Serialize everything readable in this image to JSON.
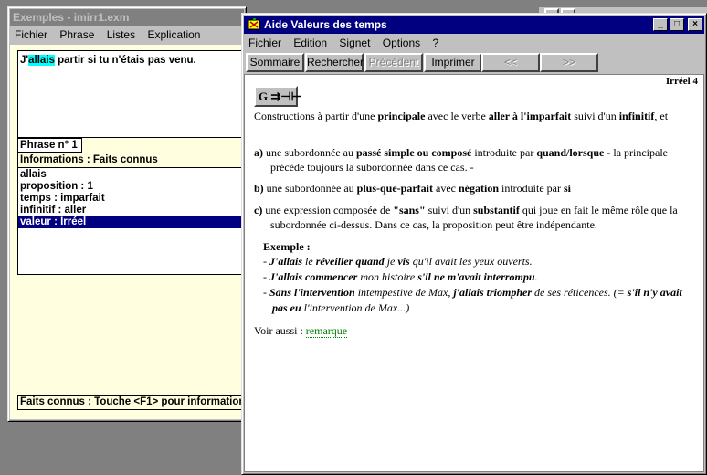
{
  "back_window": {
    "title": "Exemples - imirr1.exm",
    "menu": [
      "Fichier",
      "Phrase",
      "Listes",
      "Explication"
    ],
    "sentence_highlight": "allais",
    "sentence_pre": "J'",
    "sentence_post": " partir si tu n'étais pas venu.",
    "phrase_number": "Phrase n° 1",
    "info_header": "Informations : Faits connus",
    "info_rows": [
      "allais",
      "proposition : 1",
      "temps : imparfait",
      "infinitif : aller",
      "valeur : Irréel"
    ],
    "status": "Faits connus : Touche <F1> pour information"
  },
  "help_window": {
    "title": "Aide Valeurs des temps",
    "title_buttons": [
      "_",
      "□",
      "×"
    ],
    "menu": [
      "Fichier",
      "Edition",
      "Signet",
      "Options",
      "?"
    ],
    "toolbar": {
      "sommaire": "Sommaire",
      "rechercher": "Rechercher",
      "precedent": "Précédent",
      "imprimer": "Imprimer",
      "back": "<<",
      "forward": ">>"
    },
    "page_label": "Irréel 4",
    "graph_button": "G ⇉⊣⊢",
    "intro": {
      "t1": "Constructions à partir d'une ",
      "b1": "principale",
      "t2": " avec le verbe ",
      "b2": "aller à l'imparfait",
      "t3": " suivi d'un ",
      "b3": "infinitif",
      "t4": ", et"
    },
    "a": {
      "lbl": "a)",
      "t1": " une subordonnée au ",
      "b1": "passé simple ou composé",
      "t2": " introduite par ",
      "b2": "quand/lorsque",
      "t3": " - la principale précède toujours la subordonnée dans ce cas. -"
    },
    "b": {
      "lbl": "b)",
      "t1": " une subordonnée au ",
      "b1": "plus-que-parfait",
      "t2": " avec ",
      "b2": "négation",
      "t3": " introduite par ",
      "b3": "si"
    },
    "c": {
      "lbl": "c)",
      "t1": " une expression composée de ",
      "b1": "\"sans\"",
      "t2": " suivi d'un ",
      "b2": "substantif",
      "t3": " qui joue en fait le même rôle que la subordonnée ci-dessus. Dans ce cas, la proposition peut être indépendante."
    },
    "example_title": "Exemple :",
    "ex1": {
      "d": "- ",
      "b1": "J'allais",
      "t1": " le ",
      "b2": "réveiller quand",
      "t2": " je ",
      "b3": "vis",
      "t3": " qu'il avait les yeux ouverts."
    },
    "ex2": {
      "d": "- ",
      "b1": "J'allais commencer",
      "t1": " mon histoire ",
      "b2": "s'il ne m'avait interrompu",
      "t2": "."
    },
    "ex3": {
      "d": "- ",
      "b1": "Sans l'intervention",
      "t1": " intempestive de Max, ",
      "b2": "j'allais triompher",
      "t2": " de ses réticences. ",
      "t3": "(= ",
      "b3": "s'il n'y avait pas eu",
      "t4": " l'intervention de Max...)"
    },
    "see_also_label": "Voir aussi : ",
    "see_also_link": "remarque"
  },
  "colors": {
    "active_title": "#000080",
    "inactive_title": "#808080",
    "highlight": "#00ffff",
    "link": "#008000",
    "pane_bg": "#ffffe0"
  }
}
